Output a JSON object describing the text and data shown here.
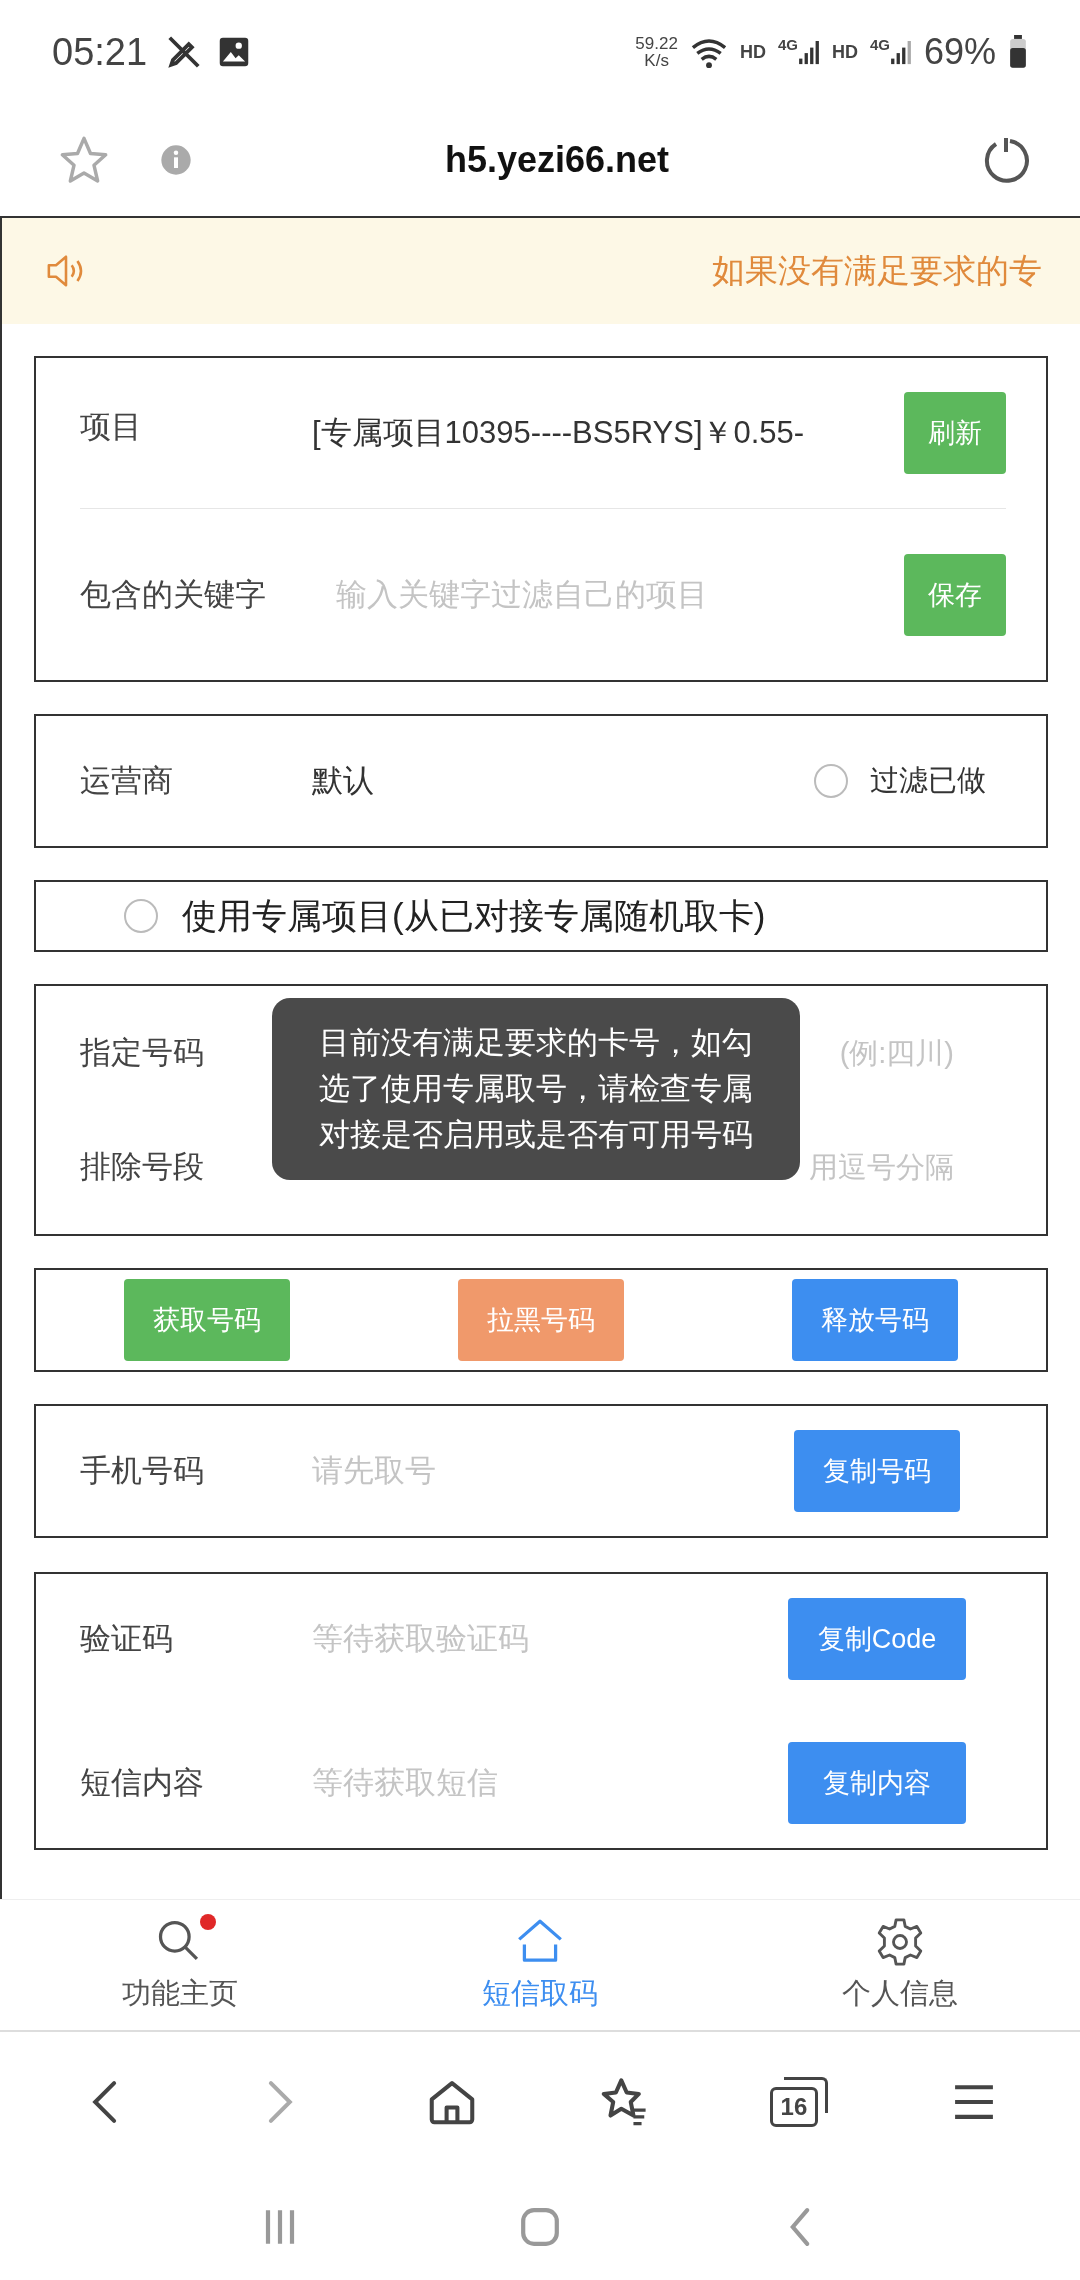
{
  "status_bar": {
    "time": "05:21",
    "net_speed": "59.22",
    "net_unit": "K/s",
    "network_labels": [
      "HD",
      "4G",
      "HD",
      "4G"
    ],
    "battery": "69%"
  },
  "browser": {
    "url": "h5.yezi66.net"
  },
  "notice": {
    "text": "如果没有满足要求的专"
  },
  "project_card": {
    "project_label": "项目",
    "project_value": "[专属项目10395----BS5RYS]￥0.55-",
    "refresh_button": "刷新",
    "keyword_label": "包含的关键字",
    "keyword_placeholder": "输入关键字过滤自己的项目",
    "save_button": "保存"
  },
  "carrier_card": {
    "label": "运营商",
    "value": "默认",
    "filter_done": {
      "label": "过滤已做",
      "checked": false
    }
  },
  "exclusive_option": {
    "label": "使用专属项目(从已对接专属随机取卡)",
    "checked": false
  },
  "number_card": {
    "rows": [
      {
        "label": "指定号码",
        "placeholder": "(例:四川)"
      },
      {
        "label": "排除号段",
        "placeholder": "用逗号分隔"
      }
    ]
  },
  "actions": [
    {
      "label": "获取号码",
      "color": "#5cb85c"
    },
    {
      "label": "拉黑号码",
      "color": "#f0996b"
    },
    {
      "label": "释放号码",
      "color": "#3d8ef0"
    }
  ],
  "phone_card": {
    "label": "手机号码",
    "placeholder": "请先取号",
    "copy_button": "复制号码"
  },
  "sms_card": {
    "rows": [
      {
        "label": "验证码",
        "placeholder": "等待获取验证码",
        "button": "复制Code"
      },
      {
        "label": "短信内容",
        "placeholder": "等待获取短信",
        "button": "复制内容"
      }
    ]
  },
  "toast": {
    "text": "目前没有满足要求的卡号，如勾选了使用专属取号，请检查专属对接是否启用或是否有可用号码"
  },
  "tab_bar": [
    {
      "label": "功能主页",
      "selected": false,
      "badge": true,
      "kind": "search"
    },
    {
      "label": "短信取码",
      "selected": true,
      "badge": false,
      "kind": "home"
    },
    {
      "label": "个人信息",
      "selected": false,
      "badge": false,
      "kind": "gear"
    }
  ],
  "browser_toolbar": {
    "tab_count": "16"
  }
}
